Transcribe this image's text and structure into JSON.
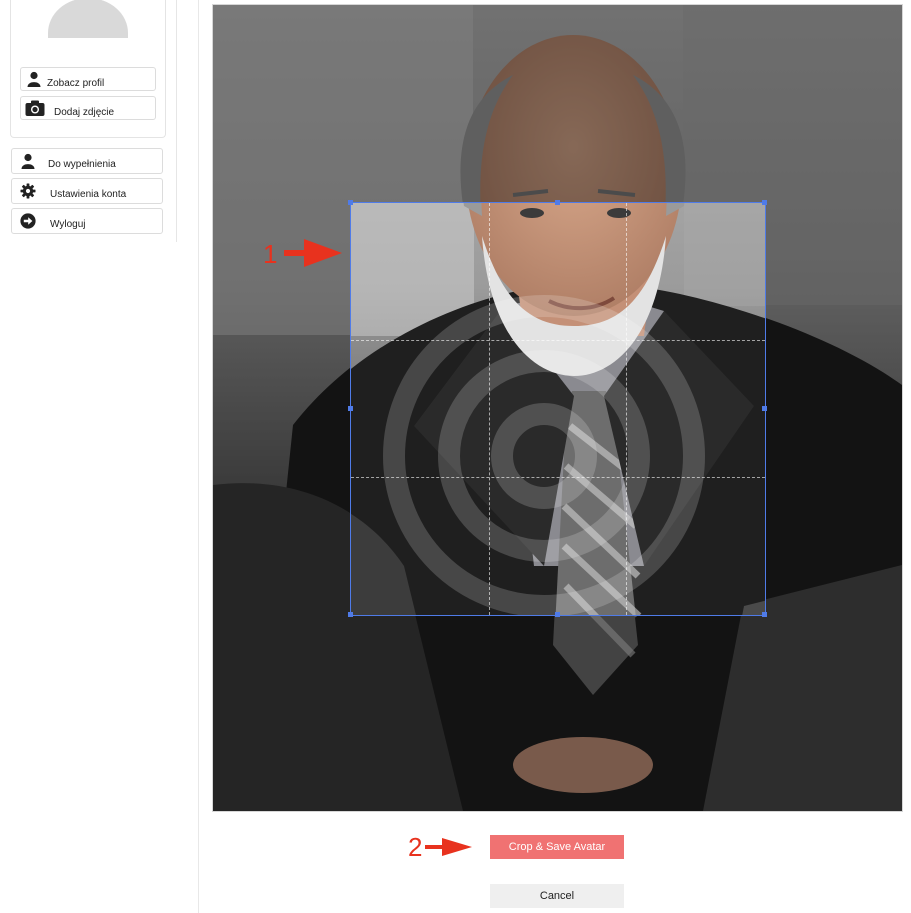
{
  "sidebar": {
    "profile_buttons": [
      {
        "label": "Zobacz profil",
        "icon": "user-icon"
      },
      {
        "label": "Dodaj zdjęcie",
        "icon": "camera-icon"
      }
    ],
    "nav_items": [
      {
        "label": "Do wypełnienia",
        "icon": "user-icon"
      },
      {
        "label": "Ustawienia konta",
        "icon": "gear-icon"
      },
      {
        "label": "Wyloguj",
        "icon": "arrow-circle-right-icon"
      }
    ]
  },
  "editor": {
    "annotations": [
      "1",
      "2"
    ],
    "crop_button_label": "Crop & Save Avatar",
    "cancel_button_label": "Cancel"
  },
  "colors": {
    "accent": "#f07272",
    "crop_border": "#4f7be8",
    "annotation": "#e8321e"
  }
}
